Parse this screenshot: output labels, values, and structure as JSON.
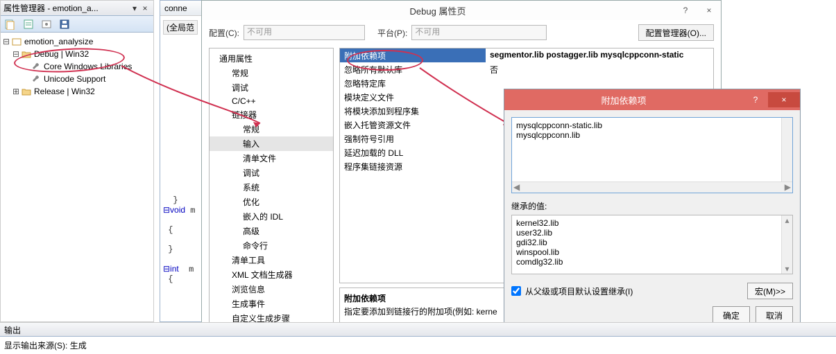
{
  "pm": {
    "title": "属性管理器 - emotion_a...",
    "tree": {
      "root": "emotion_analysize",
      "debug": "Debug | Win32",
      "core": "Core Windows Libraries",
      "unicode": "Unicode Support",
      "release": "Release | Win32"
    }
  },
  "code": {
    "tab": "conne",
    "scope": "(全局范",
    "lines": [
      "}",
      "⊟void m",
      "",
      "{",
      "",
      "}",
      "",
      "⊟int m",
      "{"
    ]
  },
  "dlg": {
    "title": "Debug 属性页",
    "help": "?",
    "close": "×",
    "cfg_label": "配置(C):",
    "cfg_value": "不可用",
    "plat_label": "平台(P):",
    "plat_value": "不可用",
    "cfg_mgr": "配置管理器(O)...",
    "categories": {
      "general": "通用属性",
      "regular1": "常规",
      "debug": "调试",
      "cpp": "C/C++",
      "linker": "链接器",
      "regular2": "常规",
      "input": "输入",
      "manifest": "清单文件",
      "dbg2": "调试",
      "system": "系统",
      "optimize": "优化",
      "idl": "嵌入的 IDL",
      "advanced": "高级",
      "cmdline": "命令行",
      "manifest_tool": "清单工具",
      "xmlgen": "XML 文档生成器",
      "browse": "浏览信息",
      "buildevt": "生成事件",
      "custom": "自定义生成步骤"
    },
    "grid": [
      {
        "k": "附加依赖项",
        "v": "segmentor.lib postagger.lib mysqlcppconn-static"
      },
      {
        "k": "忽略所有默认库",
        "v": "否"
      },
      {
        "k": "忽略特定库",
        "v": ""
      },
      {
        "k": "模块定义文件",
        "v": ""
      },
      {
        "k": "将模块添加到程序集",
        "v": ""
      },
      {
        "k": "嵌入托管资源文件",
        "v": ""
      },
      {
        "k": "强制符号引用",
        "v": ""
      },
      {
        "k": "延迟加载的 DLL",
        "v": ""
      },
      {
        "k": "程序集链接资源",
        "v": ""
      }
    ],
    "desc_title": "附加依赖项",
    "desc_body": "指定要添加到链接行的附加项(例如: kerne"
  },
  "modal": {
    "title": "附加依赖项",
    "help": "?",
    "close": "×",
    "lines": [
      "mysqlcppconn-static.lib",
      "mysqlcppconn.lib"
    ],
    "inherit_label": "继承的值:",
    "inherit": [
      "kernel32.lib",
      "user32.lib",
      "gdi32.lib",
      "winspool.lib",
      "comdlg32.lib"
    ],
    "chk": "从父级或项目默认设置继承(I)",
    "macro": "宏(M)>>",
    "ok": "确定",
    "cancel": "取消"
  },
  "output": {
    "header": "输出",
    "src_label": "显示输出来源(S):",
    "src_value": "生成"
  }
}
